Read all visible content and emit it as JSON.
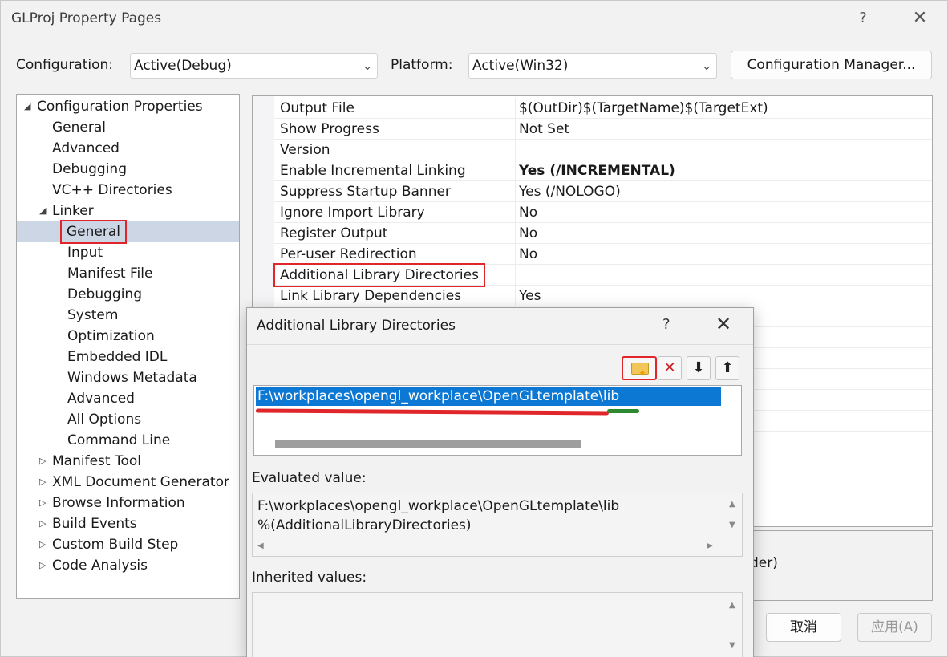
{
  "window": {
    "title": "GLProj Property Pages",
    "help": "?",
    "close": "✕"
  },
  "toolbar": {
    "configuration_label": "Configuration:",
    "configuration_value": "Active(Debug)",
    "platform_label": "Platform:",
    "platform_value": "Active(Win32)",
    "config_manager_label": "Configuration Manager..."
  },
  "tree": {
    "items": [
      {
        "label": "Configuration Properties",
        "state": "expanded"
      },
      {
        "label": "General"
      },
      {
        "label": "Advanced"
      },
      {
        "label": "Debugging"
      },
      {
        "label": "VC++ Directories"
      },
      {
        "label": "Linker",
        "state": "expanded"
      },
      {
        "label": "General",
        "selected": true
      },
      {
        "label": "Input"
      },
      {
        "label": "Manifest File"
      },
      {
        "label": "Debugging"
      },
      {
        "label": "System"
      },
      {
        "label": "Optimization"
      },
      {
        "label": "Embedded IDL"
      },
      {
        "label": "Windows Metadata"
      },
      {
        "label": "Advanced"
      },
      {
        "label": "All Options"
      },
      {
        "label": "Command Line"
      },
      {
        "label": "Manifest Tool",
        "state": "collapsed"
      },
      {
        "label": "XML Document Generator",
        "state": "collapsed"
      },
      {
        "label": "Browse Information",
        "state": "collapsed"
      },
      {
        "label": "Build Events",
        "state": "collapsed"
      },
      {
        "label": "Custom Build Step",
        "state": "collapsed"
      },
      {
        "label": "Code Analysis",
        "state": "collapsed"
      }
    ]
  },
  "grid": {
    "rows": [
      {
        "name": "Output File",
        "value": "$(OutDir)$(TargetName)$(TargetExt)"
      },
      {
        "name": "Show Progress",
        "value": "Not Set"
      },
      {
        "name": "Version",
        "value": ""
      },
      {
        "name": "Enable Incremental Linking",
        "value": "Yes (/INCREMENTAL)"
      },
      {
        "name": "Suppress Startup Banner",
        "value": "Yes (/NOLOGO)"
      },
      {
        "name": "Ignore Import Library",
        "value": "No"
      },
      {
        "name": "Register Output",
        "value": "No"
      },
      {
        "name": "Per-user Redirection",
        "value": "No"
      },
      {
        "name": "Additional Library Directories",
        "value": ""
      },
      {
        "name": "Link Library Dependencies",
        "value": "Yes"
      }
    ]
  },
  "description_fragment": "der)",
  "buttons": {
    "cancel": "取消",
    "apply": "应用(A)"
  },
  "dialog": {
    "title": "Additional Library Directories",
    "help": "?",
    "close": "✕",
    "directory": "F:\\workplaces\\opengl_workplace\\OpenGLtemplate\\lib",
    "evaluated_label": "Evaluated value:",
    "evaluated_line1": "F:\\workplaces\\opengl_workplace\\OpenGLtemplate\\lib",
    "evaluated_line2": "%(AdditionalLibraryDirectories)",
    "inherited_label": "Inherited values:"
  },
  "icons": {
    "new_line": "new-folder-icon",
    "delete": "delete-x-icon",
    "move_down": "arrow-down-icon",
    "move_up": "arrow-up-icon"
  },
  "colors": {
    "highlight": "#0d78d4",
    "annotation_red": "#e0262b",
    "annotation_green": "#2e8a2e",
    "tree_selection": "#cdd6e4"
  }
}
